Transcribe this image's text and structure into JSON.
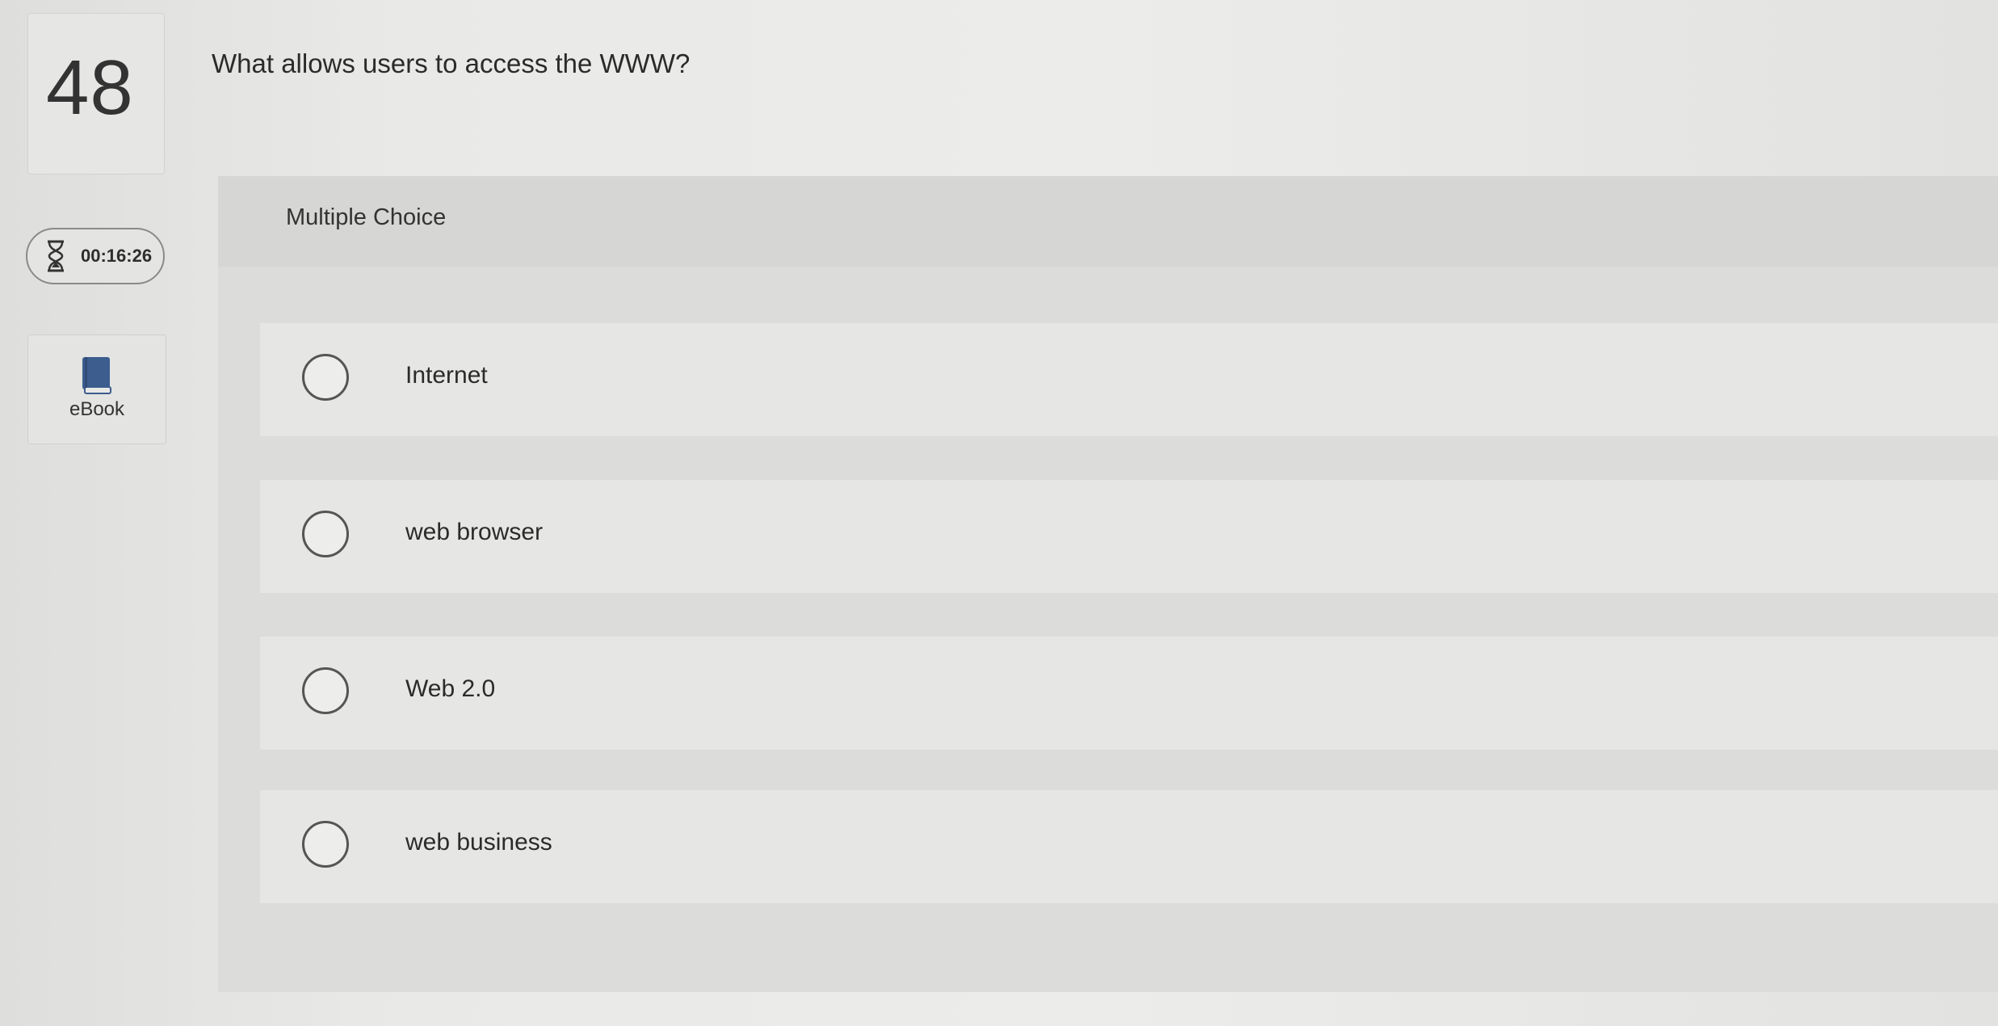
{
  "question": {
    "number": "48",
    "text": "What allows users to access the WWW?"
  },
  "timer": {
    "icon": "hourglass-icon",
    "value": "00:16:26"
  },
  "ebook": {
    "icon": "book-icon",
    "label": "eBook"
  },
  "answer_area": {
    "type_label": "Multiple Choice",
    "options": [
      {
        "label": "Internet"
      },
      {
        "label": "web browser"
      },
      {
        "label": "Web 2.0"
      },
      {
        "label": "web business"
      }
    ]
  },
  "colors": {
    "background": "#e7e7e5",
    "panel": "#dcdcda",
    "option_row": "#e6e6e4",
    "book_icon": "#3c5d8e"
  }
}
